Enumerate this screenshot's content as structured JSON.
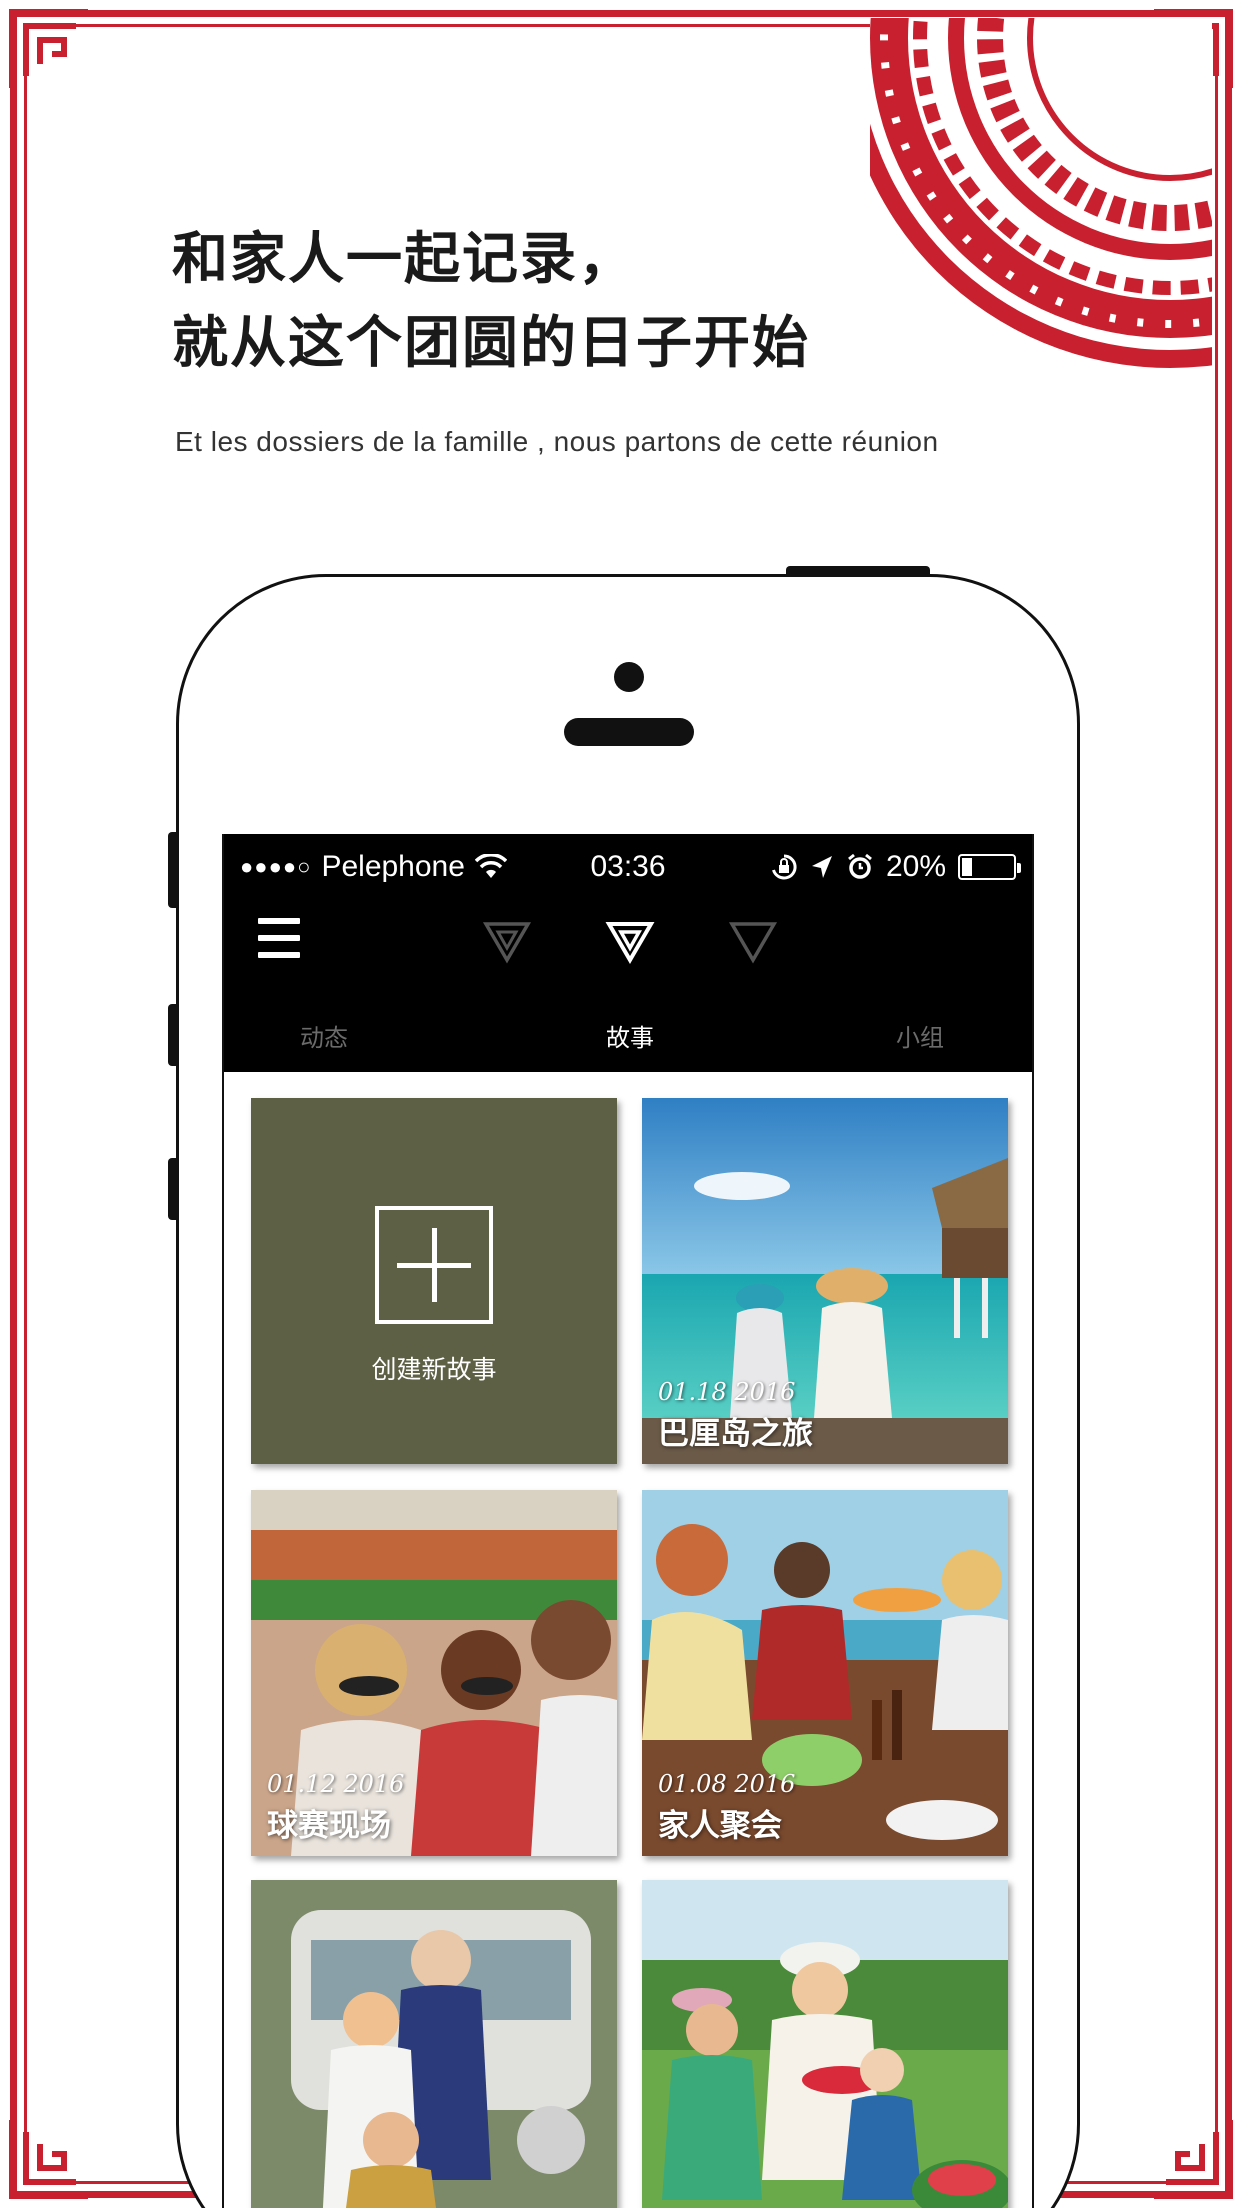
{
  "promo": {
    "headline_line1": "和家人一起记录，",
    "headline_line2": "就从这个团圆的日子开始",
    "subline": "Et les dossiers de la famille , nous partons de cette réunion"
  },
  "theme": {
    "frame_red": "#c8202f",
    "create_tile_bg": "#5e6046",
    "appbar_bg": "#000000"
  },
  "status_bar": {
    "signal": "●●●●○",
    "carrier": "Pelephone",
    "wifi_icon": "wifi-icon",
    "time": "03:36",
    "icons": [
      "rotation-lock-icon",
      "location-arrow-icon",
      "alarm-icon"
    ],
    "battery": "20%",
    "battery_level": 0.2
  },
  "nav": {
    "menu_icon": "hamburger-menu-icon",
    "page_indicators": [
      "triangle-icon",
      "triangle-icon-active",
      "triangle-icon"
    ],
    "tabs": [
      {
        "label": "动态",
        "active": false
      },
      {
        "label": "故事",
        "active": true
      },
      {
        "label": "小组",
        "active": false
      }
    ]
  },
  "stories": {
    "create_label": "创建新故事",
    "items": [
      {
        "date": "01.18  2016",
        "title": "巴厘岛之旅"
      },
      {
        "date": "01.12  2016",
        "title": "球赛现场"
      },
      {
        "date": "01.08  2016",
        "title": "家人聚会"
      },
      {
        "date": "",
        "title": ""
      },
      {
        "date": "",
        "title": ""
      }
    ]
  }
}
